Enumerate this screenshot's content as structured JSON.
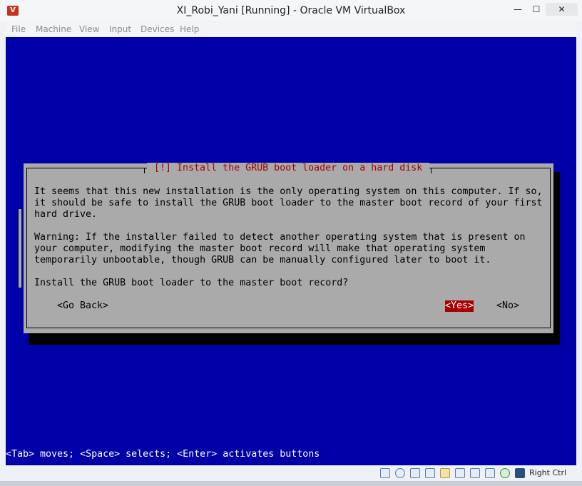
{
  "window": {
    "title": "XI_Robi_Yani [Running] - Oracle VM VirtualBox",
    "minimize_glyph": "—",
    "maximize_glyph": "☐",
    "close_glyph": "✕"
  },
  "menu": {
    "items": [
      "File",
      "Machine",
      "View",
      "Input",
      "Devices",
      "Help"
    ]
  },
  "dialog": {
    "title": "[!] Install the GRUB boot loader on a hard disk",
    "body": "It seems that this new installation is the only operating system on this computer. If so,\nit should be safe to install the GRUB boot loader to the master boot record of your first\nhard drive.\n\nWarning: If the installer failed to detect another operating system that is present on\nyour computer, modifying the master boot record will make that operating system\ntemporarily unbootable, though GRUB can be manually configured later to boot it.",
    "question": "Install the GRUB boot loader to the master boot record?",
    "go_back": "<Go Back>",
    "yes": "<Yes>",
    "no": "<No>"
  },
  "console": {
    "help_line": "<Tab> moves; <Space> selects; <Enter> activates buttons"
  },
  "statusbar": {
    "host_key": "Right Ctrl",
    "icons": [
      "hard-disk-icon",
      "optical-disk-icon",
      "usb-icon",
      "shared-folder-icon",
      "pen-icon",
      "folder-icon",
      "display-icon",
      "capture-icon",
      "network-icon",
      "mouse-integration-icon",
      "keyboard-icon"
    ]
  },
  "colors": {
    "console_blue": "#0000a8",
    "dialog_gray": "#aaaaaa",
    "dialog_title_red": "#a80000",
    "yes_highlight": "#a80000"
  }
}
